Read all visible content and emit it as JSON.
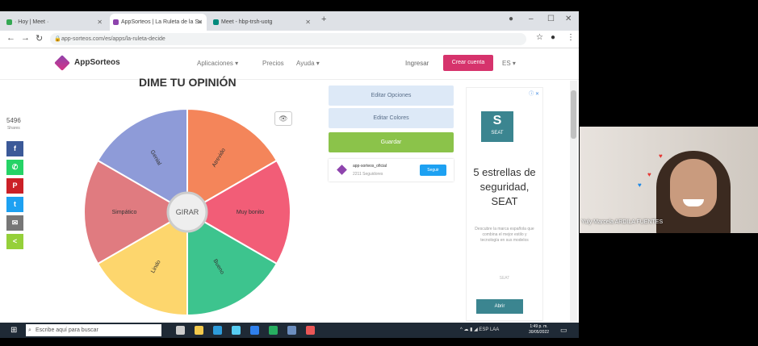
{
  "browser": {
    "tabs": [
      {
        "label": "· Hoy | Meet ·",
        "favicon_color": "#34a853",
        "active": false
      },
      {
        "label": "AppSorteos | La Ruleta de la Su",
        "favicon_color": "#8e44ad",
        "active": true
      },
      {
        "label": "Meet - hbp-trsh-uotg",
        "favicon_color": "#00897b",
        "active": false
      }
    ],
    "url": "app-sorteos.com/es/apps/la-ruleta-decide"
  },
  "site": {
    "logo_text": "AppSorteos",
    "menu": [
      "Aplicaciones ▾",
      "Precios",
      "Ayuda ▾"
    ],
    "ingresar": "Ingresar",
    "crear_cuenta": "Crear cuenta",
    "lang": "ES ▾"
  },
  "page": {
    "title": "DIME TU OPINIÓN",
    "share_count": "5496",
    "share_label": "Shares",
    "social": [
      {
        "name": "facebook",
        "glyph": "f",
        "color": "#3b5998"
      },
      {
        "name": "whatsapp",
        "glyph": "✆",
        "color": "#25d366"
      },
      {
        "name": "pinterest",
        "glyph": "P",
        "color": "#cb2027"
      },
      {
        "name": "twitter",
        "glyph": "t",
        "color": "#1da1f2"
      },
      {
        "name": "email",
        "glyph": "✉",
        "color": "#777777"
      },
      {
        "name": "share",
        "glyph": "<",
        "color": "#95d03a"
      }
    ],
    "wheel": {
      "center_label": "GIRAR",
      "segments": [
        {
          "label": "Atrevido",
          "color": "#f4855a"
        },
        {
          "label": "Muy bonito",
          "color": "#f25d77"
        },
        {
          "label": "Bueno",
          "color": "#3dc48e"
        },
        {
          "label": "Lindo",
          "color": "#fdd66d"
        },
        {
          "label": "Simpático",
          "color": "#e07b80"
        },
        {
          "label": "Genial",
          "color": "#8e9bd8"
        }
      ]
    },
    "buttons": {
      "editar_opciones": "Editar Opciones",
      "editar_colores": "Editar Colores",
      "guardar": "Guardar"
    },
    "profile": {
      "name": "app-sorteos_oficial",
      "followers": "2211 Seguidores",
      "follow": "Seguir"
    }
  },
  "ad": {
    "choices": "ⓘ ✕",
    "logo": "SEAT",
    "headline": "5 estrellas de seguridad, SEAT",
    "body": "Descubre la marca española que combina el mejor estilo y tecnología en sus modelos",
    "more": "SEAT",
    "button": "Abrir"
  },
  "taskbar": {
    "search_placeholder": "Escribe aquí para buscar",
    "tray": "^ ☁ ▮ ◢ ESP LAA",
    "time": "1:49 p. m.",
    "date": "30/05/2022",
    "icons": [
      {
        "name": "task-view",
        "color": "#cccccc"
      },
      {
        "name": "file-explorer",
        "color": "#f2c94c"
      },
      {
        "name": "edge",
        "color": "#2d9cdb"
      },
      {
        "name": "store",
        "color": "#56ccf2"
      },
      {
        "name": "mail",
        "color": "#2f80ed"
      },
      {
        "name": "chrome",
        "color": "#27ae60"
      },
      {
        "name": "teams",
        "color": "#6c8ebf"
      },
      {
        "name": "firefox",
        "color": "#eb5757"
      }
    ]
  },
  "video": {
    "participant_name": "Yuly Marcela ARDILA FUENTES"
  }
}
